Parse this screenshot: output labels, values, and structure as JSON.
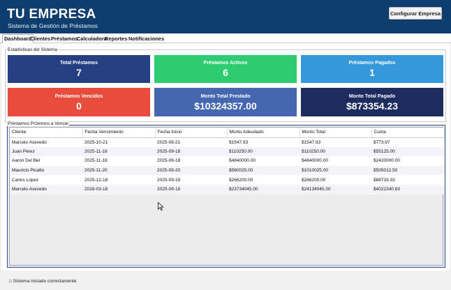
{
  "header": {
    "title": "TU EMPRESA",
    "subtitle": "Sistema de Gestión de Préstamos",
    "config_button": "Configurar Empresa"
  },
  "tabs": [
    "Dashboard",
    "Clientes",
    "Préstamos",
    "Calculadora",
    "Reportes",
    "Notificaciones"
  ],
  "stats": {
    "group_label": "Estadísticas del Sistema",
    "cards": [
      {
        "label": "Total Préstamos",
        "value": "7",
        "color": "#263f82"
      },
      {
        "label": "Préstamos Activos",
        "value": "6",
        "color": "#2ecc71"
      },
      {
        "label": "Préstamos Pagados",
        "value": "1",
        "color": "#3498db"
      },
      {
        "label": "Préstamos Vencidos",
        "value": "0",
        "color": "#e74c3c"
      },
      {
        "label": "Monto Total Prestado",
        "value": "$10324357.00",
        "color": "#4567b2"
      },
      {
        "label": "Monto Total Pagado",
        "value": "$873354.23",
        "color": "#1c2c5e"
      }
    ]
  },
  "loans": {
    "group_label": "Préstamos Próximos a Vencer",
    "columns": [
      "Cliente",
      "Fecha Vencimiento",
      "Fecha Inicio",
      "Monto Adeudado",
      "Monto Total",
      "Cuota"
    ],
    "rows": [
      [
        "Marcelo Asevedo",
        "2025-10-21",
        "2025-08-21",
        "$1547.93",
        "$1547.93",
        "$773.97"
      ],
      [
        "Juan Pérez",
        "2025-11-18",
        "2025-09-18",
        "$110250.00",
        "$110250.00",
        "$55125.00"
      ],
      [
        "Aaron Del Bel",
        "2025-11-18",
        "2025-09-18",
        "$4840000.00",
        "$4840000.00",
        "$2420000.00"
      ],
      [
        "Mauricio Picatto",
        "2025-11-20",
        "2025-09-20",
        "$560025.00",
        "$1010025.00",
        "$505012.50"
      ],
      [
        "Carlos López",
        "2025-12-18",
        "2025-09-18",
        "$266200.00",
        "$266200.00",
        "$88733.33"
      ],
      [
        "Marcelo Asevedo",
        "2026-03-18",
        "2025-09-18",
        "$23734045.00",
        "$24134045.00",
        "$4022340.83"
      ]
    ]
  },
  "status": {
    "text": "□ Sistema iniciado correctamente"
  }
}
